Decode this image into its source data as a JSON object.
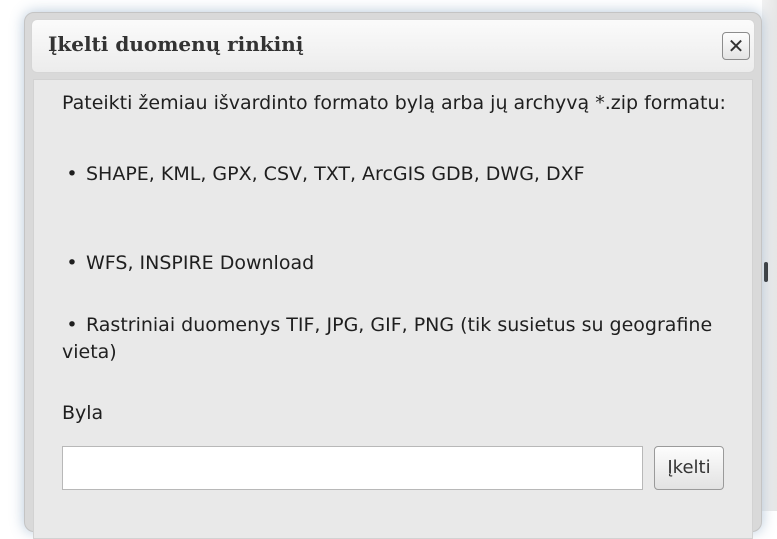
{
  "dialog": {
    "title": "Įkelti duomenų rinkinį",
    "close_icon": "close-icon",
    "close_symbol": "✕"
  },
  "content": {
    "intro": "Pateikti žemiau išvardinto formato bylą arba jų archyvą *.zip formatu:",
    "bullet_symbol": "•",
    "formats": [
      "SHAPE, KML, GPX, CSV, TXT, ArcGIS GDB, DWG, DXF",
      "WFS, INSPIRE Download",
      "Rastriniai duomenys TIF, JPG, GIF, PNG (tik susietus su geografine vieta)"
    ],
    "file_label": "Byla",
    "file_value": "",
    "upload_button": "Įkelti"
  }
}
